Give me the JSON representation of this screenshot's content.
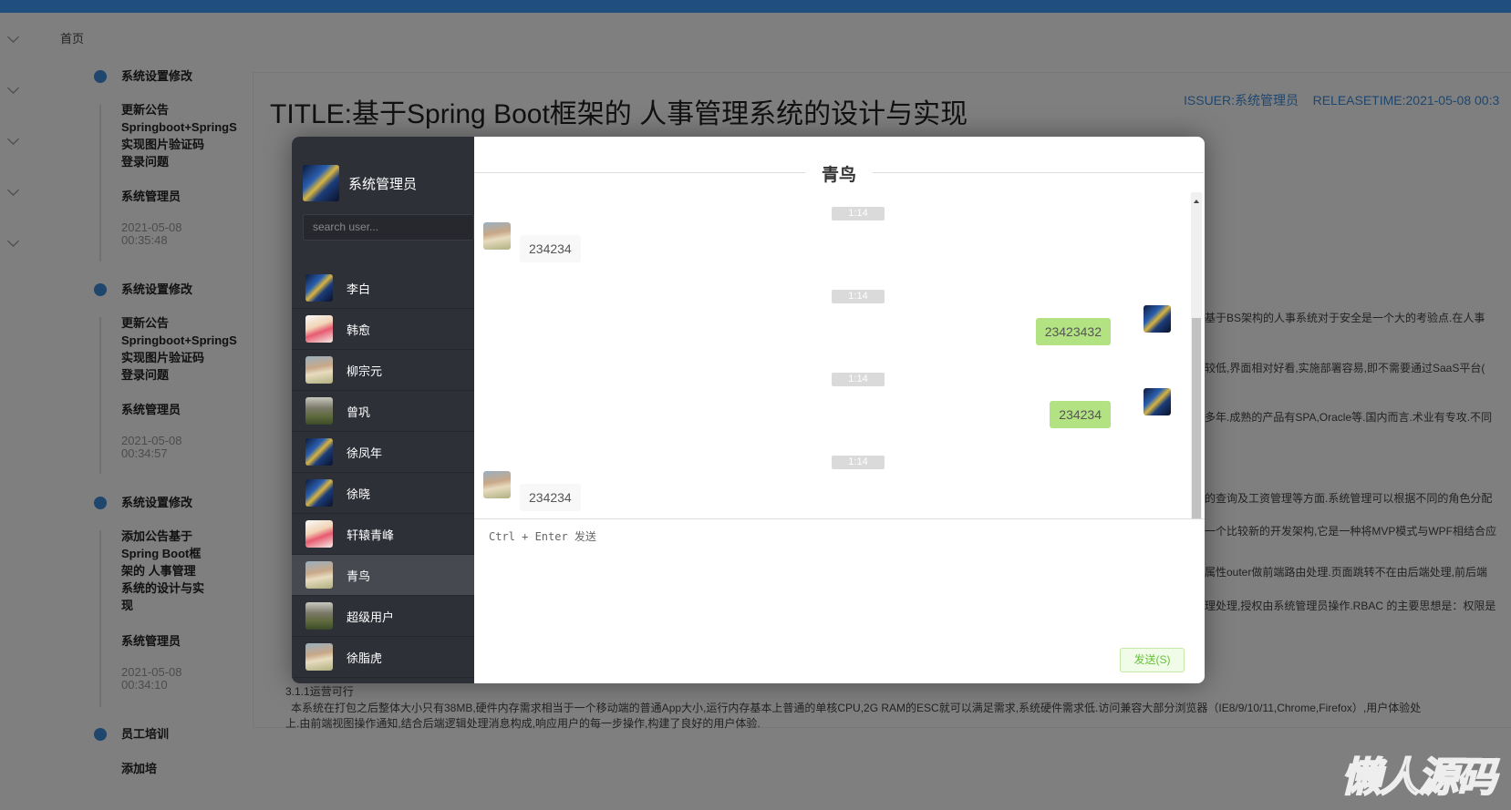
{
  "nav": {
    "home": "首页"
  },
  "timeline": [
    {
      "type": "系统设置修改",
      "content": [
        "更新公告",
        "Springboot+SpringS",
        "实现图片验证码",
        "登录问题"
      ],
      "author": "系统管理员",
      "date": "2021-05-08",
      "time": "00:35:48"
    },
    {
      "type": "系统设置修改",
      "content": [
        "更新公告",
        "Springboot+SpringS",
        "实现图片验证码",
        "登录问题"
      ],
      "author": "系统管理员",
      "date": "2021-05-08",
      "time": "00:34:57"
    },
    {
      "type": "系统设置修改",
      "content": [
        "添加公告基于",
        "Spring Boot框",
        "架的 人事管理",
        "系统的设计与实",
        "现"
      ],
      "author": "系统管理员",
      "date": "2021-05-08",
      "time": "00:34:10"
    },
    {
      "type": "员工培训",
      "content": [
        "添加培"
      ]
    }
  ],
  "article": {
    "title": "TITLE:基于Spring Boot框架的 人事管理系统的设计与实现",
    "issuer": "ISSUER:系统管理员",
    "releasetime": "RELEASETIME:2021-05-08 00:3",
    "right_lines": [
      "基于BS架构的人事系统对于安全是一个大的考验点.在人事",
      "较低,界面相对好看,实施部署容易,即不需要通过SaaS平台(",
      "多年.成熟的产品有SPA,Oracle等.国内而言.术业有专攻.不同",
      "的查询及工资管理等方面.系统管理可以根据不同的角色分配",
      "一个比较新的开发架构,它是一种将MVP模式与WPF相结合应",
      "属性outer做前端路由处理.页面跳转不在由后端处理,前后端",
      "理处理,授权由系统管理员操作.RBAC 的主要思想是：权限是"
    ],
    "bottom_lines": [
      "3.1.1运营可行",
      "本系统在打包之后整体大小只有38MB,硬件内存需求相当于一个移动端的普通App大小,运行内存基本上普通的单核CPU,2G RAM的ESC就可以满足需求,系统硬件需求低.访问兼容大部分浏览器（IE8/9/10/11,Chrome,Firefox）,用户体验处",
      "上.由前端视图操作通知,结合后端逻辑处理消息构成,响应用户的每一步操作,构建了良好的用户体验."
    ]
  },
  "chat": {
    "me": {
      "name": "系统管理员",
      "avatar": "city"
    },
    "search_placeholder": "search user...",
    "contacts": [
      {
        "name": "李白",
        "avatar": "city"
      },
      {
        "name": "韩愈",
        "avatar": "girls"
      },
      {
        "name": "柳宗元",
        "avatar": "cam"
      },
      {
        "name": "曾巩",
        "avatar": "mount"
      },
      {
        "name": "徐凤年",
        "avatar": "city"
      },
      {
        "name": "徐晓",
        "avatar": "city"
      },
      {
        "name": "轩辕青峰",
        "avatar": "girls"
      },
      {
        "name": "青鸟",
        "avatar": "cam",
        "active": true
      },
      {
        "name": "超级用户",
        "avatar": "mount"
      },
      {
        "name": "徐脂虎",
        "avatar": "cam"
      }
    ],
    "title": "青鸟",
    "messages": [
      {
        "time": "1:14",
        "text": "234234",
        "direction": "in"
      },
      {
        "time": "1:14",
        "text": "23423432",
        "direction": "out"
      },
      {
        "time": "1:14",
        "text": "234234",
        "direction": "out"
      },
      {
        "time": "1:14",
        "text": "234234",
        "direction": "in"
      }
    ],
    "input_hint": "Ctrl + Enter 发送",
    "send_label": "发送(S)"
  },
  "watermark": "懒人源码",
  "colors": {
    "accent": "#3f8ddb",
    "sent_bubble": "#b2e281",
    "sidebar": "#2e3038"
  }
}
